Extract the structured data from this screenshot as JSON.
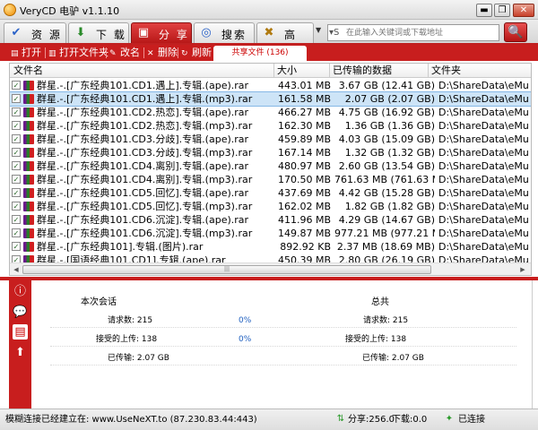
{
  "window": {
    "title": "VeryCD 电驴 v1.1.10",
    "buttons": [
      "▬",
      "❐",
      "✕"
    ]
  },
  "main_tabs": [
    {
      "label": "资 源",
      "icon": "resource-icon",
      "glyph": "✔"
    },
    {
      "label": "下 载",
      "icon": "download-icon",
      "glyph": "⬇"
    },
    {
      "label": "分 享",
      "icon": "share-icon",
      "glyph": "▣"
    },
    {
      "label": "搜索",
      "icon": "search-tab-icon",
      "glyph": "◎"
    },
    {
      "label": "高 级",
      "icon": "tools-icon",
      "glyph": "✖"
    }
  ],
  "search": {
    "placeholder": "在此输入关键词或下载地址",
    "type_glyph": "▾S",
    "go_glyph": "🔍"
  },
  "subtoolbar": {
    "open": "打开",
    "open_folder": "打开文件夹",
    "rename": "改名",
    "delete": "删除",
    "refresh": "刷新",
    "shared_tab": "共享文件 (136)"
  },
  "columns": {
    "name": "文件名",
    "size": "大小",
    "transferred": "已传输的数据",
    "folder": "文件夹"
  },
  "files": [
    {
      "name": "群星.-.[广东经典101.CD1.遇上].专辑.(ape).rar",
      "size": "443.01 MB",
      "transferred": "3.67 GB (12.41 GB)",
      "folder": "D:\\ShareData\\eMule"
    },
    {
      "name": "群星.-.[广东经典101.CD1.遇上].专辑.(mp3).rar",
      "size": "161.58 MB",
      "transferred": "2.07 GB (2.07 GB)",
      "folder": "D:\\ShareData\\eMule"
    },
    {
      "name": "群星.-.[广东经典101.CD2.热恋].专辑.(ape).rar",
      "size": "466.27 MB",
      "transferred": "4.75 GB (16.92 GB)",
      "folder": "D:\\ShareData\\eMule"
    },
    {
      "name": "群星.-.[广东经典101.CD2.热恋].专辑.(mp3).rar",
      "size": "162.30 MB",
      "transferred": "1.36 GB (1.36 GB)",
      "folder": "D:\\ShareData\\eMule"
    },
    {
      "name": "群星.-.[广东经典101.CD3.分歧].专辑.(ape).rar",
      "size": "459.89 MB",
      "transferred": "4.03 GB (15.09 GB)",
      "folder": "D:\\ShareData\\eMule"
    },
    {
      "name": "群星.-.[广东经典101.CD3.分歧].专辑.(mp3).rar",
      "size": "167.14 MB",
      "transferred": "1.32 GB (1.32 GB)",
      "folder": "D:\\ShareData\\eMule"
    },
    {
      "name": "群星.-.[广东经典101.CD4.离别].专辑.(ape).rar",
      "size": "480.97 MB",
      "transferred": "2.60 GB (13.54 GB)",
      "folder": "D:\\ShareData\\eMule"
    },
    {
      "name": "群星.-.[广东经典101.CD4.离别].专辑.(mp3).rar",
      "size": "170.50 MB",
      "transferred": "761.63 MB (761.63 MB)",
      "folder": "D:\\ShareData\\eMule"
    },
    {
      "name": "群星.-.[广东经典101.CD5.回忆].专辑.(ape).rar",
      "size": "437.69 MB",
      "transferred": "4.42 GB (15.28 GB)",
      "folder": "D:\\ShareData\\eMule"
    },
    {
      "name": "群星.-.[广东经典101.CD5.回忆].专辑.(mp3).rar",
      "size": "162.02 MB",
      "transferred": "1.82 GB (1.82 GB)",
      "folder": "D:\\ShareData\\eMule"
    },
    {
      "name": "群星.-.[广东经典101.CD6.沉淀].专辑.(ape).rar",
      "size": "411.96 MB",
      "transferred": "4.29 GB (14.67 GB)",
      "folder": "D:\\ShareData\\eMule"
    },
    {
      "name": "群星.-.[广东经典101.CD6.沉淀].专辑.(mp3).rar",
      "size": "149.87 MB",
      "transferred": "977.21 MB (977.21 MB)",
      "folder": "D:\\ShareData\\eMule"
    },
    {
      "name": "群星.-.[广东经典101].专辑.(图片).rar",
      "size": "892.92 KB",
      "transferred": "2.37 MB (18.69 MB)",
      "folder": "D:\\ShareData\\eMule"
    },
    {
      "name": "群星.-.[国语经典101.CD1].专辑.(ape).rar",
      "size": "450.39 MB",
      "transferred": "2.80 GB (26.19 GB)",
      "folder": "D:\\ShareData\\eMule"
    }
  ],
  "selected_row": 1,
  "stats": {
    "session_title": "本次会话",
    "total_title": "总共",
    "session": {
      "requests_label": "请求数: 215",
      "requests_pct": "0%",
      "accepted_label": "接受的上传: 138",
      "accepted_pct": "0%",
      "transferred_label": "已传输: 2.07 GB"
    },
    "total": {
      "requests_label": "请求数: 215",
      "accepted_label": "接受的上传: 138",
      "transferred_label": "已传输: 2.07 GB"
    }
  },
  "statusbar": {
    "connection": "模糊连接已经建立在: www.UseNeXT.to (87.230.83.44:443)",
    "upload": "分享:256.0",
    "download": "下载:0.0",
    "connected": "已连接"
  },
  "colors": {
    "accent": "#c81e1e",
    "selected": "#cde4f7",
    "link": "#2060c0"
  }
}
